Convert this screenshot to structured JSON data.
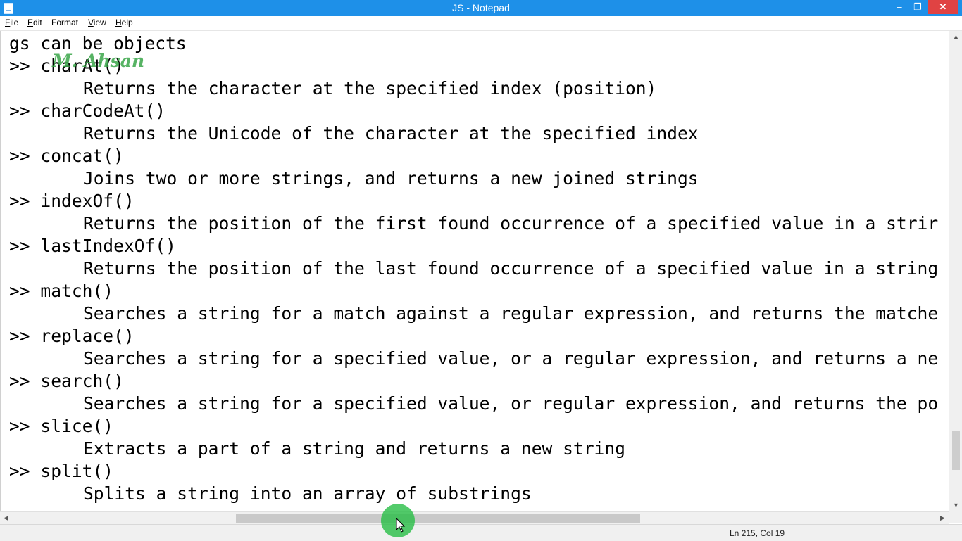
{
  "window": {
    "title": "JS - Notepad"
  },
  "titlebar_controls": {
    "minimize": "–",
    "maximize": "❐",
    "close": "✕"
  },
  "menu": [
    {
      "mnemonic": "F",
      "rest": "ile"
    },
    {
      "mnemonic": "E",
      "rest": "dit"
    },
    {
      "mnemonic": "",
      "rest": "Format"
    },
    {
      "mnemonic": "V",
      "rest": "iew"
    },
    {
      "mnemonic": "H",
      "rest": "elp"
    }
  ],
  "editor": {
    "lines": [
      "gs can be objects",
      ">> charAt()",
      "Returns the character at the specified index (position)",
      ">> charCodeAt()",
      "Returns the Unicode of the character at the specified index",
      ">> concat()",
      "Joins two or more strings, and returns a new joined strings",
      ">> indexOf()",
      "Returns the position of the first found occurrence of a specified value in a strir",
      ">> lastIndexOf()",
      "Returns the position of the last found occurrence of a specified value in a string",
      ">> match()",
      "Searches a string for a match against a regular expression, and returns the matche",
      ">> replace()",
      "Searches a string for a specified value, or a regular expression, and returns a ne",
      ">> search()",
      "Searches a string for a specified value, or regular expression, and returns the po",
      ">> slice()",
      "Extracts a part of a string and returns a new string",
      ">> split()",
      "Splits a string into an array of substrings"
    ],
    "watermark": "M. Ahsan"
  },
  "scroll": {
    "horizontal_position": 0.43,
    "vertical_position": 0.93,
    "left_arrow": "◀",
    "right_arrow": "▶",
    "up_arrow": "▲",
    "down_arrow": "▼"
  },
  "status": {
    "position": "Ln 215, Col 19"
  },
  "colors": {
    "titlebar": "#1e90e8",
    "close_button": "#e04343",
    "cursor_highlight": "#28be46"
  },
  "icons": [
    "notepad-icon",
    "minimize-icon",
    "maximize-icon",
    "close-icon",
    "mouse-cursor-icon"
  ]
}
